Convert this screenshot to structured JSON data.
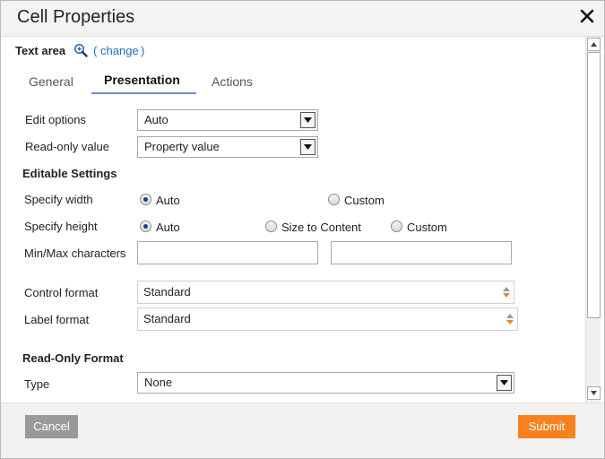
{
  "dialog": {
    "title": "Cell Properties"
  },
  "header": {
    "control_type": "Text area",
    "paren_open": "(",
    "change_link": "change",
    "paren_close": ")"
  },
  "tabs": [
    {
      "label": "General",
      "active": false
    },
    {
      "label": "Presentation",
      "active": true
    },
    {
      "label": "Actions",
      "active": false
    }
  ],
  "form": {
    "edit_options": {
      "label": "Edit options",
      "value": "Auto"
    },
    "read_only_value": {
      "label": "Read-only value",
      "value": "Property value"
    },
    "editable_settings_heading": "Editable Settings",
    "specify_width": {
      "label": "Specify width",
      "options": [
        {
          "label": "Auto",
          "selected": true
        },
        {
          "label": "Custom",
          "selected": false
        }
      ]
    },
    "specify_height": {
      "label": "Specify height",
      "options": [
        {
          "label": "Auto",
          "selected": true
        },
        {
          "label": "Size to Content",
          "selected": false
        },
        {
          "label": "Custom",
          "selected": false
        }
      ]
    },
    "min_max_characters": {
      "label": "Min/Max characters",
      "min_value": "",
      "max_value": ""
    },
    "control_format": {
      "label": "Control format",
      "value": "Standard"
    },
    "label_format": {
      "label": "Label format",
      "value": "Standard"
    },
    "read_only_format_heading": "Read-Only Format",
    "type": {
      "label": "Type",
      "value": "None"
    }
  },
  "footer": {
    "cancel_label": "Cancel",
    "submit_label": "Submit"
  },
  "colors": {
    "submit": "#f7821f",
    "cancel": "#9a9a9a",
    "link": "#1f6fb5",
    "tab_underline": "#6a8fc5"
  },
  "icons": {
    "close": "close-icon",
    "zoom": "magnifier-icon",
    "dropdown": "chevron-down-icon",
    "spinner": "up-down-icon"
  }
}
